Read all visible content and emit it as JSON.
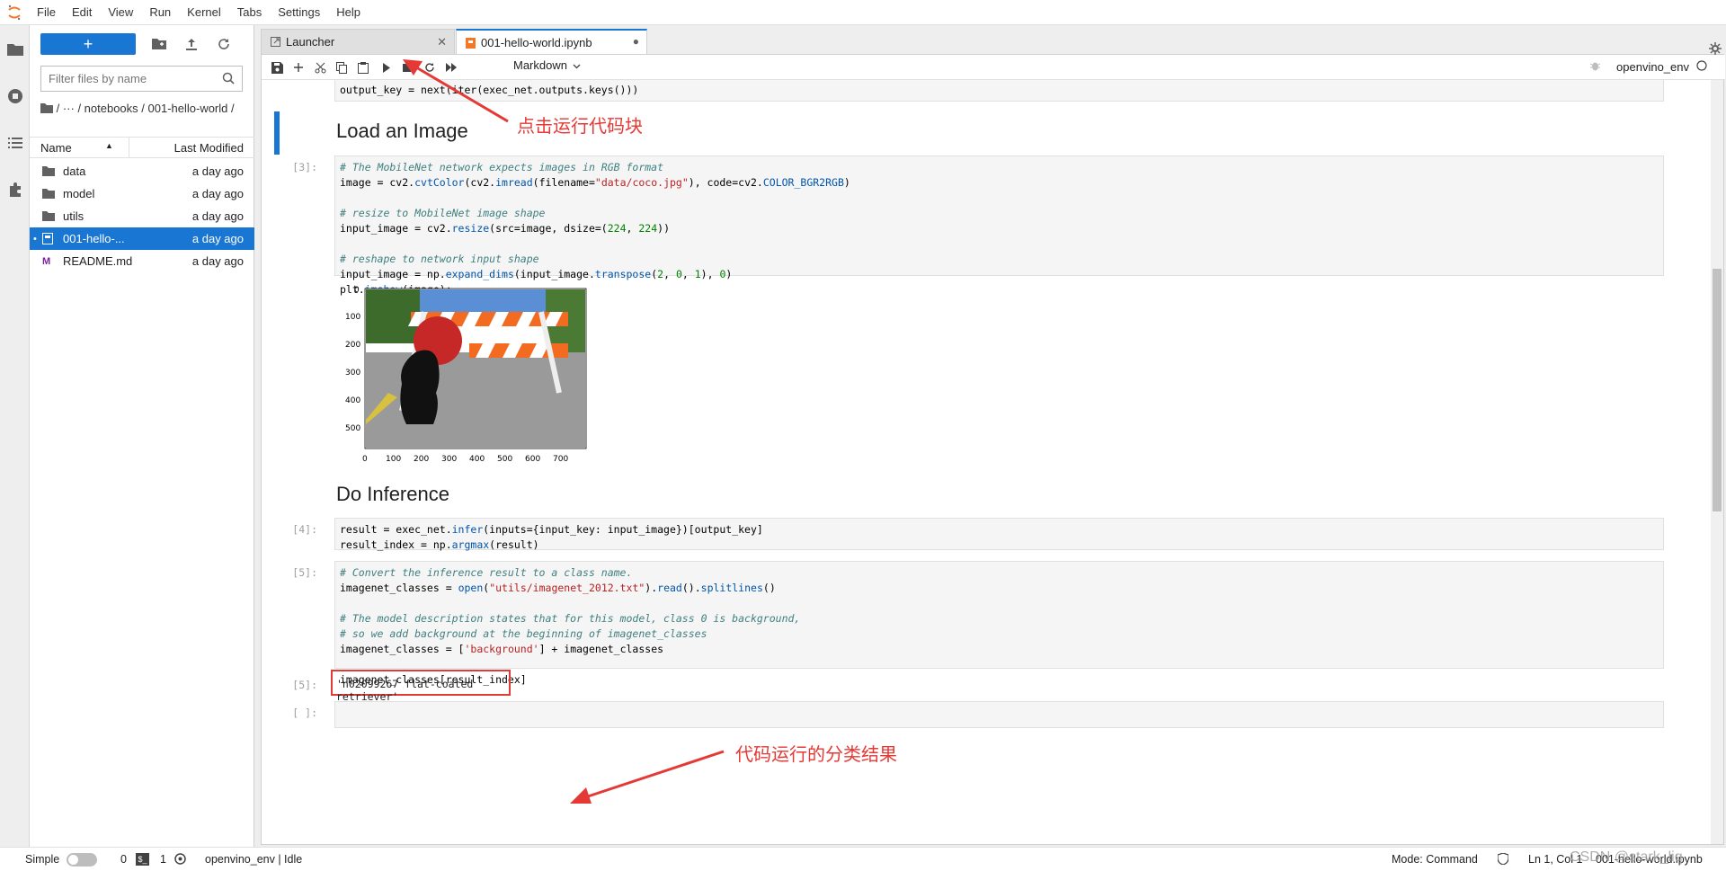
{
  "menubar": {
    "items": [
      "File",
      "Edit",
      "View",
      "Run",
      "Kernel",
      "Tabs",
      "Settings",
      "Help"
    ]
  },
  "filebrowser": {
    "new_label": "+",
    "search_placeholder": "Filter files by name",
    "breadcrumb": "/  ···  / notebooks / 001-hello-world /",
    "col_name": "Name",
    "col_modified": "Last Modified",
    "items": [
      {
        "name": "data",
        "modified": "a day ago",
        "icon": "folder-icon"
      },
      {
        "name": "model",
        "modified": "a day ago",
        "icon": "folder-icon"
      },
      {
        "name": "utils",
        "modified": "a day ago",
        "icon": "folder-icon"
      },
      {
        "name": "001-hello-...",
        "modified": "a day ago",
        "icon": "notebook-icon",
        "selected": true,
        "running": "•"
      },
      {
        "name": "README.md",
        "modified": "a day ago",
        "icon": "markdown-icon"
      }
    ]
  },
  "tabs": [
    {
      "label": "Launcher",
      "icon": "launcher-icon",
      "close": "✕"
    },
    {
      "label": "001-hello-world.ipynb",
      "icon": "notebook-icon",
      "close": "●"
    }
  ],
  "toolbar": {
    "cell_type": "Markdown",
    "kernel": "openvino_env"
  },
  "notebook": {
    "top_partial_code": "output_key = next(iter(exec_net.outputs.keys()))",
    "heading_load": "Load an Image",
    "cell3_prompt": "[3]:",
    "heading_infer": "Do Inference",
    "cell4_prompt": "[4]:",
    "cell5_prompt": "[5]:",
    "out5_prompt": "[5]:",
    "output_text": "'n02099267 flat-coated retriever'",
    "empty_prompt": "[ ]:",
    "plot_yticks": [
      "0",
      "100",
      "200",
      "300",
      "400",
      "500"
    ],
    "plot_xticks": [
      "0",
      "100",
      "200",
      "300",
      "400",
      "500",
      "600",
      "700"
    ]
  },
  "annotations": {
    "run_note": "点击运行代码块",
    "result_note": "代码运行的分类结果"
  },
  "statusbar": {
    "mode_label": "Simple",
    "count_a": "0",
    "count_b": "1",
    "kernel_status": "openvino_env | Idle",
    "mode": "Mode: Command",
    "position": "Ln 1, Col 1",
    "file": "001-hello-world.ipynb",
    "watermark": "CSDN @stark_liq"
  },
  "colors": {
    "accent": "#1976d2",
    "annotation": "#e53935"
  }
}
